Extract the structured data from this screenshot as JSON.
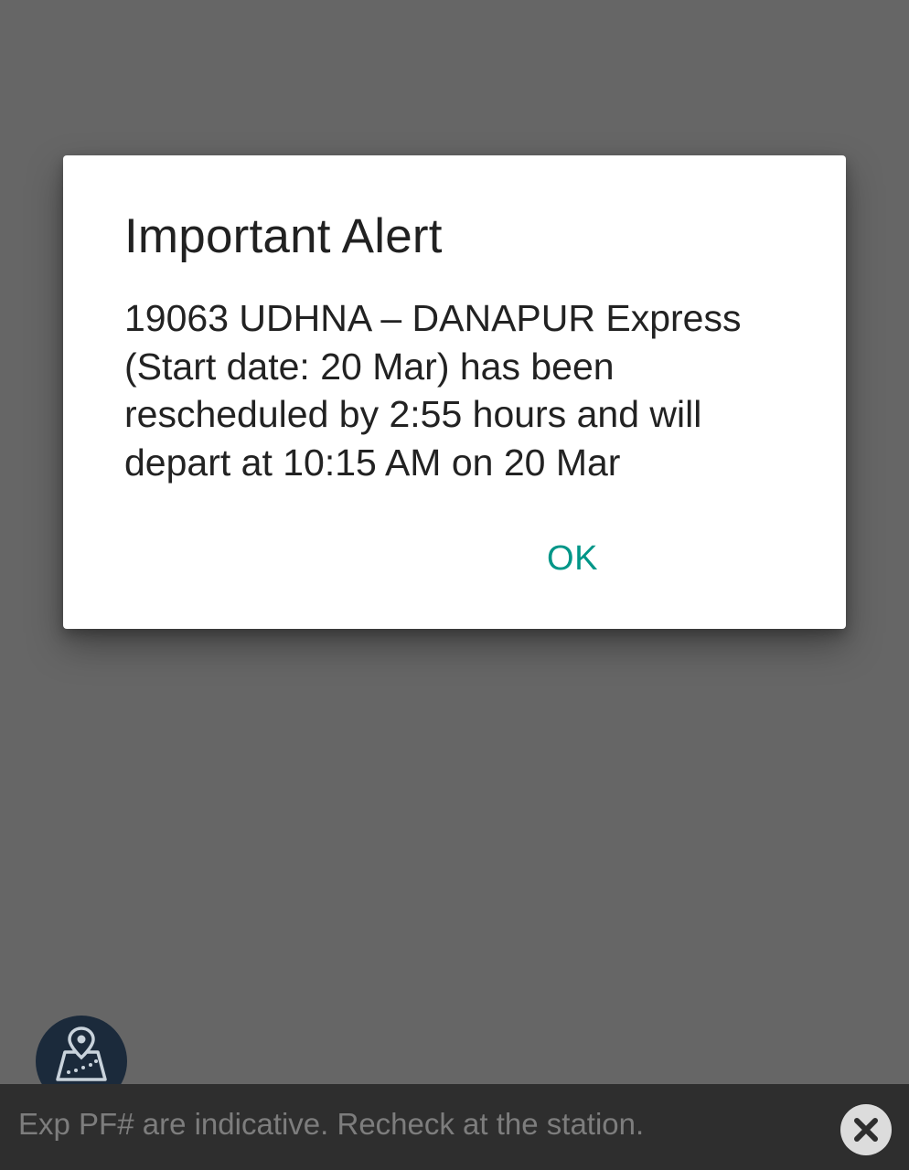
{
  "dialog": {
    "title": "Important Alert",
    "message": "19063 UDHNA – DANAPUR Express (Start date: 20 Mar) has been rescheduled by 2:55 hours and will depart at 10:15 AM on 20 Mar",
    "ok_label": "OK"
  },
  "map_fab": {
    "icon": "map-route-icon"
  },
  "banner": {
    "text": "Exp PF# are indicative. Recheck at the station.",
    "close_icon": "close-icon"
  },
  "colors": {
    "accent": "#009688",
    "scrim": "#666666",
    "banner_bg": "#2e2e2e",
    "fab_bg": "#1b2a3b"
  }
}
